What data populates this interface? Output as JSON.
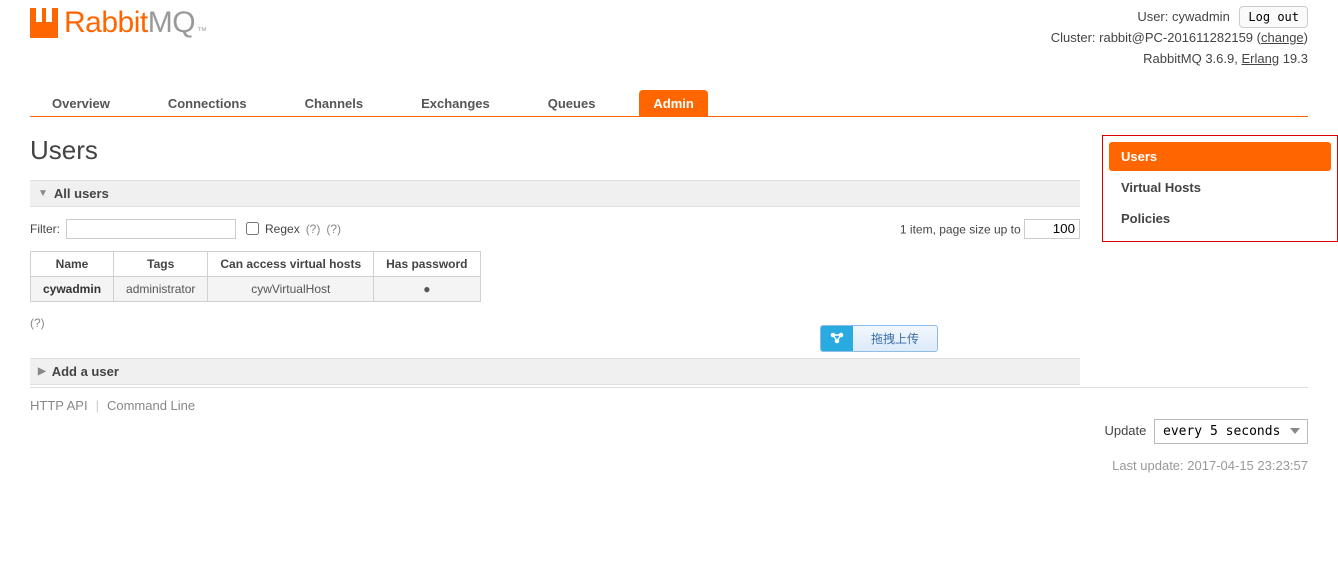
{
  "header": {
    "brand_left": "Rabbit",
    "brand_right": "MQ",
    "tm": "™",
    "user_label": "User:",
    "user": "cywadmin",
    "logout": "Log out",
    "cluster_label": "Cluster:",
    "cluster": "rabbit@PC-201611282159",
    "change": "change",
    "version_prefix": "RabbitMQ",
    "version": "3.6.9",
    "erlang_label": "Erlang",
    "erlang_version": "19.3"
  },
  "tabs": [
    "Overview",
    "Connections",
    "Channels",
    "Exchanges",
    "Queues",
    "Admin"
  ],
  "active_tab": "Admin",
  "page_title": "Users",
  "sections": {
    "all_users": "All users",
    "add_user": "Add a user"
  },
  "filter": {
    "label": "Filter:",
    "value": "",
    "regex": "Regex",
    "help1": "(?)",
    "help2": "(?)",
    "pager_prefix": "1 item, page size up to",
    "page_size": "100"
  },
  "table": {
    "columns": [
      "Name",
      "Tags",
      "Can access virtual hosts",
      "Has password"
    ],
    "rows": [
      {
        "name": "cywadmin",
        "tags": "administrator",
        "vhosts": "cywVirtualHost",
        "has_password": "●"
      }
    ]
  },
  "help_standalone": "(?)",
  "side_panel": [
    "Users",
    "Virtual Hosts",
    "Policies"
  ],
  "side_active": "Users",
  "footer_links": [
    "HTTP API",
    "Command Line"
  ],
  "update": {
    "label": "Update",
    "value": "every 5 seconds"
  },
  "last_update": {
    "label": "Last update:",
    "value": "2017-04-15 23:23:57"
  },
  "upload_widget": "拖拽上传"
}
